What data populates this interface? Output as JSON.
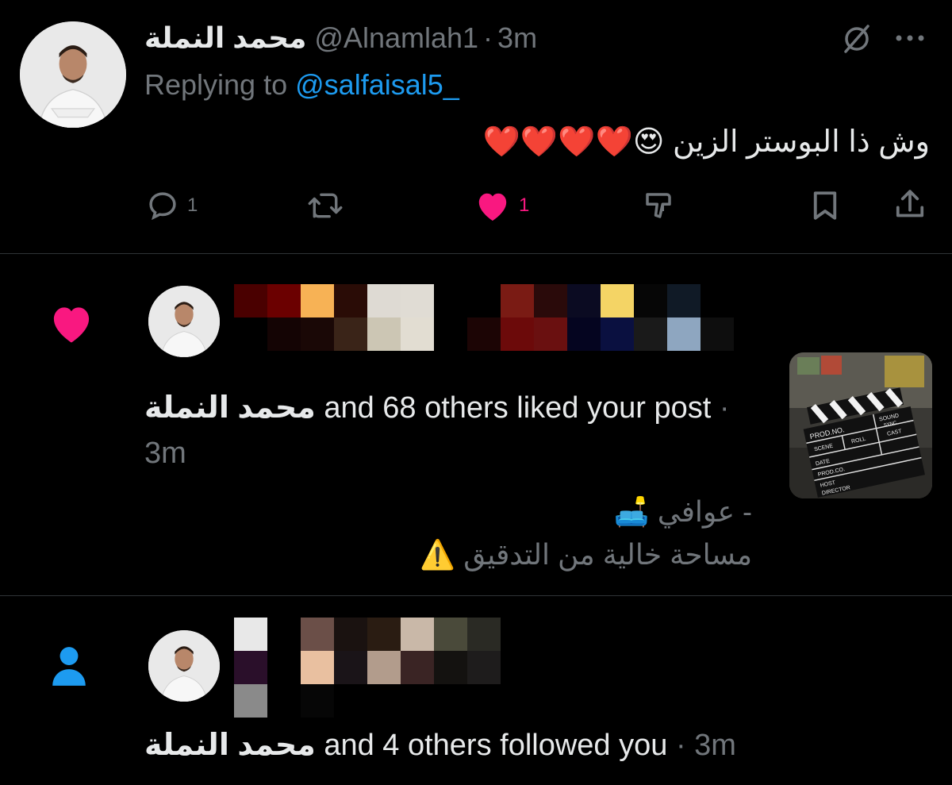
{
  "tweet": {
    "author_name": "محمد النملة",
    "handle": "@Alnamlah1",
    "separator": "·",
    "time": "3m",
    "replying_prefix": "Replying to",
    "replying_handle": "@salfaisal5_",
    "text": "وش ذا البوستر الزين 😍❤️❤️❤️❤️",
    "actions": {
      "reply_count": "1",
      "retweet_count": "",
      "like_count": "1"
    },
    "icons": [
      "grok-icon",
      "more-icon",
      "reply-icon",
      "retweet-icon",
      "heart-icon",
      "views-icon",
      "bookmark-icon",
      "share-icon"
    ]
  },
  "notifications": [
    {
      "type": "like",
      "icon": "heart-icon",
      "icon_color": "#f91880",
      "name": "محمد النملة",
      "text": "and 68 others liked your post",
      "separator": "·",
      "time": "3m",
      "post_preview_line1": "- عوافي 🛋️",
      "post_preview_line2": "مساحة خالية من التدقيق ⚠️",
      "thumbnail_clapper": {
        "prod_no": "PROD.NO.",
        "roll": "ROLL",
        "scene": "SCENE",
        "sound": "SOUND",
        "sync": "SYNC",
        "date": "DATE",
        "cast": "CAST",
        "prod_co": "PROD.CO.",
        "host": "HOST",
        "director": "DIRECTOR"
      }
    },
    {
      "type": "follow",
      "icon": "person-icon",
      "icon_color": "#1d9bf0",
      "name": "محمد النملة",
      "text": "and 4 others followed you",
      "separator": "·",
      "time": "3m"
    }
  ],
  "colors": {
    "background": "#000000",
    "text": "#e7e9ea",
    "muted": "#71767b",
    "accent": "#1d9bf0",
    "like": "#f91880",
    "divider": "#2f3336"
  }
}
